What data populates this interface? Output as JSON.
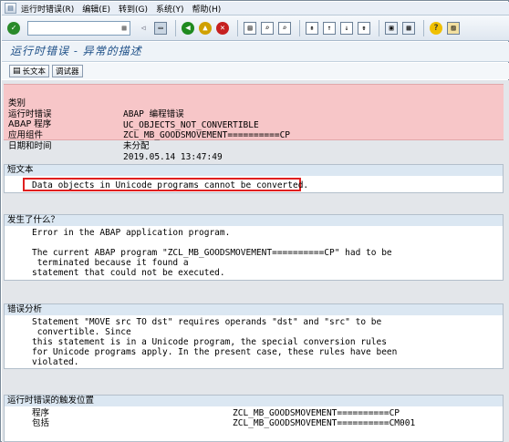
{
  "menu": {
    "items": [
      "运行时错误(R)",
      "编辑(E)",
      "转到(G)",
      "系统(Y)",
      "帮助(H)"
    ]
  },
  "toolbar": {
    "command_value": "",
    "history_glyph": "▦"
  },
  "title": "运行时错误 - 异常的描述",
  "app_toolbar": {
    "long_text_label": "长文本",
    "debugger_label": "调试器"
  },
  "header": {
    "rows": [
      {
        "key": "类别",
        "value": "ABAP 编程错误"
      },
      {
        "key": "运行时错误",
        "value": "UC_OBJECTS_NOT_CONVERTIBLE"
      },
      {
        "key": "ABAP 程序",
        "value": "ZCL_MB_GOODSMOVEMENT==========CP"
      },
      {
        "key": "应用组件",
        "value": "未分配"
      },
      {
        "key": "日期和时间",
        "value": "2019.05.14 13:47:49"
      }
    ]
  },
  "sections": {
    "short_text": {
      "heading": "短文本",
      "lines": [
        "Data objects in Unicode programs cannot be converted."
      ]
    },
    "what_happened": {
      "heading": "发生了什么？",
      "lines": [
        "Error in the ABAP application program.",
        "",
        "The current ABAP program \"ZCL_MB_GOODSMOVEMENT==========CP\" had to be",
        " terminated because it found a",
        "statement that could not be executed."
      ]
    },
    "error_analysis": {
      "heading": "错误分析",
      "lines": [
        "Statement \"MOVE src TO dst\" requires operands \"dst\" and \"src\" to be",
        " convertible. Since",
        "this statement is in a Unicode program, the special conversion rules",
        "for Unicode programs apply. In the present case, these rules have been",
        "violated."
      ]
    },
    "trigger_location": {
      "heading": "运行时错误的触发位置",
      "rows": [
        {
          "key": "程序",
          "value": "ZCL_MB_GOODSMOVEMENT==========CP"
        },
        {
          "key": "包括",
          "value": "ZCL_MB_GOODSMOVEMENT==========CM001"
        }
      ]
    }
  },
  "colors": {
    "header_bg": "#f7c6c8",
    "section_heading_bg": "#dbe7f2",
    "title_text": "#1d4f87",
    "highlight_border": "#e02020"
  }
}
